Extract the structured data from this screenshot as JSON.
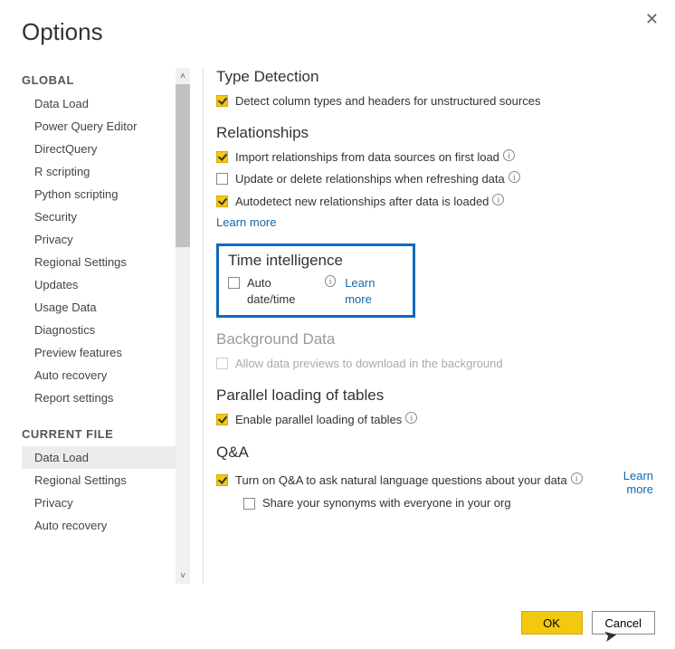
{
  "dialog": {
    "title": "Options"
  },
  "sidebar": {
    "cat_global": "GLOBAL",
    "cat_current": "CURRENT FILE",
    "global_items": [
      "Data Load",
      "Power Query Editor",
      "DirectQuery",
      "R scripting",
      "Python scripting",
      "Security",
      "Privacy",
      "Regional Settings",
      "Updates",
      "Usage Data",
      "Diagnostics",
      "Preview features",
      "Auto recovery",
      "Report settings"
    ],
    "current_items": [
      "Data Load",
      "Regional Settings",
      "Privacy",
      "Auto recovery"
    ],
    "selected": "current.0"
  },
  "content": {
    "type_detection": {
      "heading": "Type Detection",
      "opt1_label": "Detect column types and headers for unstructured sources",
      "opt1_checked": true
    },
    "relationships": {
      "heading": "Relationships",
      "opt1_label": "Import relationships from data sources on first load",
      "opt1_checked": true,
      "opt2_label": "Update or delete relationships when refreshing data",
      "opt2_checked": false,
      "opt3_label": "Autodetect new relationships after data is loaded",
      "opt3_checked": true,
      "learn_more": "Learn more"
    },
    "time_intel": {
      "heading": "Time intelligence",
      "opt1_label": "Auto date/time",
      "opt1_checked": false,
      "learn_more": "Learn more"
    },
    "background": {
      "heading": "Background Data",
      "opt1_label": "Allow data previews to download in the background",
      "opt1_checked": false,
      "opt1_disabled": true
    },
    "parallel": {
      "heading": "Parallel loading of tables",
      "opt1_label": "Enable parallel loading of tables",
      "opt1_checked": true
    },
    "qa": {
      "heading": "Q&A",
      "opt1_label": "Turn on Q&A to ask natural language questions about your data",
      "opt1_checked": true,
      "learn_more": "Learn more",
      "opt2_label": "Share your synonyms with everyone in your org",
      "opt2_checked": false
    }
  },
  "footer": {
    "ok": "OK",
    "cancel": "Cancel"
  }
}
